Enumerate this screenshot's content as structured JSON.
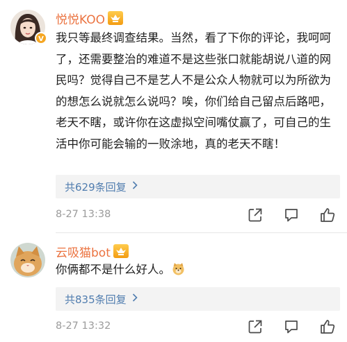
{
  "comments": [
    {
      "username": "悦悦KOO",
      "text": "我只等最终调查结果。当然，看了下你的评论，我呵呵了，还需要整治的难道不是这些张口就能胡说八道的网民吗？觉得自己不是艺人不是公众人物就可以为所欲为的想怎么说就怎么说吗？唉，你们给自己留点后路吧，老天不瞎，或许你在这虚拟空间嘴仗赢了，可自己的生活中你可能会输的一败涂地，真的老天不瞎！",
      "replies_label": "共629条回复",
      "timestamp": "8-27 13:38",
      "verified": true,
      "vip_badge": true
    },
    {
      "username": "云吸猫bot",
      "text": "你俩都不是什么好人。",
      "emoji": "doge-emoji",
      "replies_label": "共835条回复",
      "timestamp": "8-27 13:32",
      "vip_badge": true
    }
  ],
  "icons": {
    "share": "share-icon",
    "comment": "comment-icon",
    "like": "thumbs-up-icon",
    "chevron": "chevron-right-icon"
  },
  "colors": {
    "username": "#eb7340",
    "link": "#507daf",
    "timestamp": "#9b9b9b",
    "reply_bg": "#f3f3f3",
    "verified_badge": "#f5a623"
  }
}
